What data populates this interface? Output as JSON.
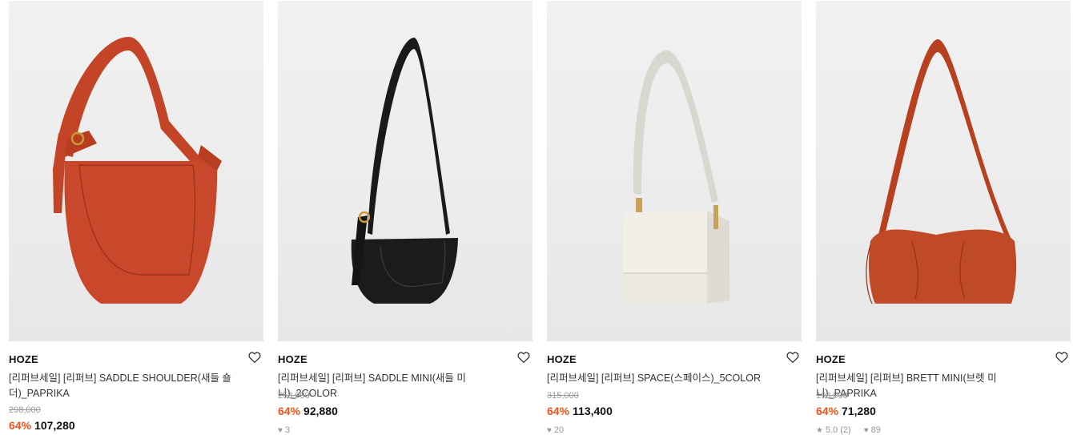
{
  "products": [
    {
      "brand": "HOZE",
      "name": "[리퍼브세일] [리퍼브] SADDLE SHOULDER(새들 숄더)_PAPRIKA",
      "original_price": "298,000",
      "discount": "64%",
      "price": "107,280",
      "likes": "",
      "rating": "",
      "review_count": "",
      "bag_color": "#c9472a"
    },
    {
      "brand": "HOZE",
      "name": "[리퍼브세일] [리퍼브] SADDLE MINI(새들 미니)_2COLOR",
      "original_price": "258,000",
      "discount": "64%",
      "price": "92,880",
      "likes": "3",
      "rating": "",
      "review_count": "",
      "bag_color": "#1b1b1b"
    },
    {
      "brand": "HOZE",
      "name": "[리퍼브세일] [리퍼브] SPACE(스페이스)_5COLOR",
      "original_price": "315,000",
      "discount": "64%",
      "price": "113,400",
      "likes": "20",
      "rating": "",
      "review_count": "",
      "bag_color": "#ece9e1"
    },
    {
      "brand": "HOZE",
      "name": "[리퍼브세일] [리퍼브] BRETT MINI(브렛 미니)_PAPRIKA",
      "original_price": "198,000",
      "discount": "64%",
      "price": "71,280",
      "likes": "89",
      "rating": "5.0",
      "review_count": "(2)",
      "bag_color": "#c14a26"
    }
  ],
  "colors": {
    "discount": "#f2541b",
    "original_price": "#9a9a9a",
    "meta": "#999999"
  },
  "icons": {
    "wishlist": "heart-outline-icon",
    "likes": "heart-filled-icon",
    "rating": "star-icon"
  }
}
